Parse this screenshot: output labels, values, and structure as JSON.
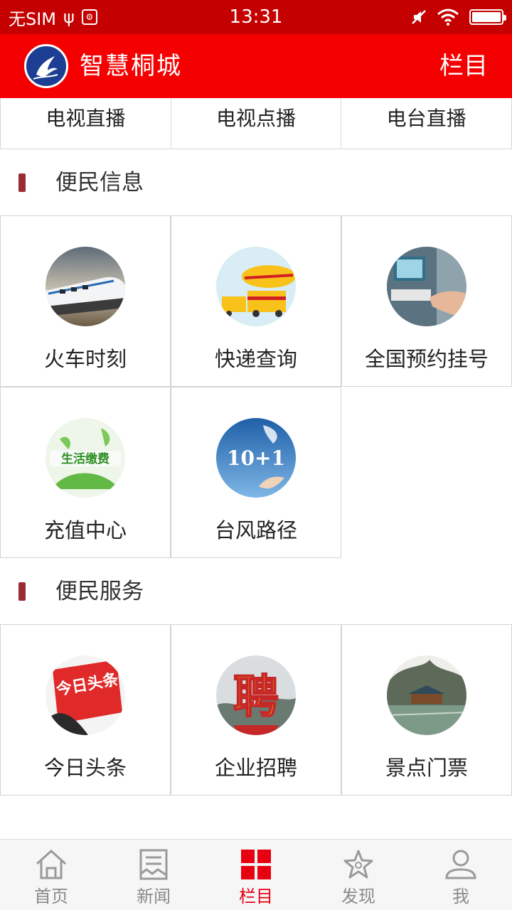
{
  "status_bar": {
    "carrier": "无SIM",
    "time": "13:31",
    "battery_level": 1.0
  },
  "app_bar": {
    "title": "智慧桐城",
    "menu_label": "栏目",
    "brand_color": "#f50000"
  },
  "live_row": [
    {
      "label": "电视直播"
    },
    {
      "label": "电视点播"
    },
    {
      "label": "电台直播"
    }
  ],
  "sections": [
    {
      "title": "便民信息",
      "tiles": [
        {
          "label": "火车时刻",
          "icon": "train-icon"
        },
        {
          "label": "快递查询",
          "icon": "delivery-truck-icon"
        },
        {
          "label": "全国预约挂号",
          "icon": "atm-icon"
        },
        {
          "label": "充值中心",
          "icon": "bill-payment-icon",
          "icon_text": "生活缴费"
        },
        {
          "label": "台风路径",
          "icon": "typhoon-icon",
          "icon_text": "10+1"
        }
      ]
    },
    {
      "title": "便民服务",
      "tiles": [
        {
          "label": "今日头条",
          "icon": "headline-news-icon",
          "icon_text": "今日头条"
        },
        {
          "label": "企业招聘",
          "icon": "recruitment-icon",
          "icon_text": "聘"
        },
        {
          "label": "景点门票",
          "icon": "scenic-spot-icon"
        }
      ]
    }
  ],
  "bottom_nav": [
    {
      "label": "首页",
      "icon": "home-icon",
      "active": false
    },
    {
      "label": "新闻",
      "icon": "news-icon",
      "active": false
    },
    {
      "label": "栏目",
      "icon": "grid-icon",
      "active": true
    },
    {
      "label": "发现",
      "icon": "discover-star-icon",
      "active": false
    },
    {
      "label": "我",
      "icon": "user-icon",
      "active": false
    }
  ],
  "colors": {
    "status_bar": "#c40000",
    "section_marker": "#9a2a33",
    "active_tab": "#e60012",
    "inactive_tab": "#8a8a8a"
  }
}
